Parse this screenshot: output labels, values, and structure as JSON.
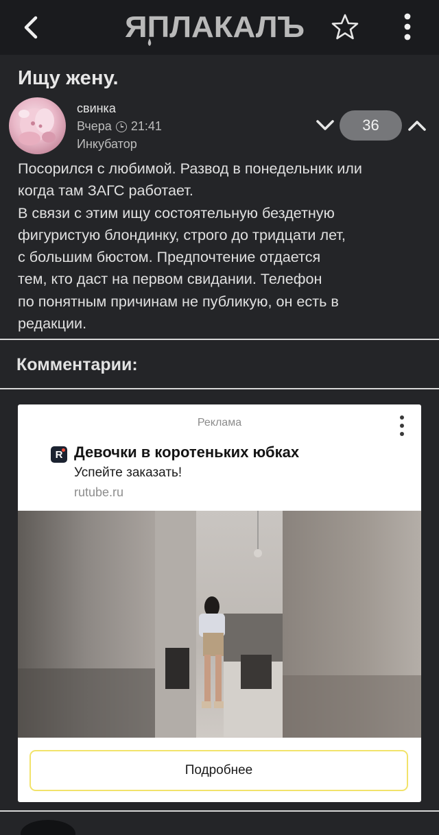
{
  "topbar": {
    "logo_text": "ЯПЛАКАЛЪ",
    "back_icon": "chevron-left-icon",
    "favorite_icon": "star-outline-icon",
    "menu_icon": "kebab-menu-icon"
  },
  "post": {
    "title": "Ищу жену.",
    "author": "свинка",
    "date": "Вчера",
    "time": "21:41",
    "section": "Инкубатор",
    "rating": "36",
    "body_lines": [
      "Посорился с любимой. Развод в понедельник или",
      "когда там ЗАГС работает.",
      "В связи с этим ищу состоятельную бездетную",
      "фигуристую блондинку, строго до тридцати лет,",
      "с большим бюстом. Предпочтение отдается",
      "тем, кто даст на первом свидании. Телефон",
      "по понятным причинам не публикую, он есть в",
      "редакции."
    ]
  },
  "comments": {
    "title": "Комментарии:"
  },
  "ad": {
    "label": "Реклама",
    "logo_letter": "R",
    "title": "Девочки в коротеньких юбках",
    "subtitle": "Успейте заказать!",
    "domain": "rutube.ru",
    "button_label": "Подробнее"
  },
  "colors": {
    "background": "#242528",
    "topbar": "#1a1b1e",
    "rating_pill": "#76777a",
    "ad_button_border": "#f2e36a"
  }
}
